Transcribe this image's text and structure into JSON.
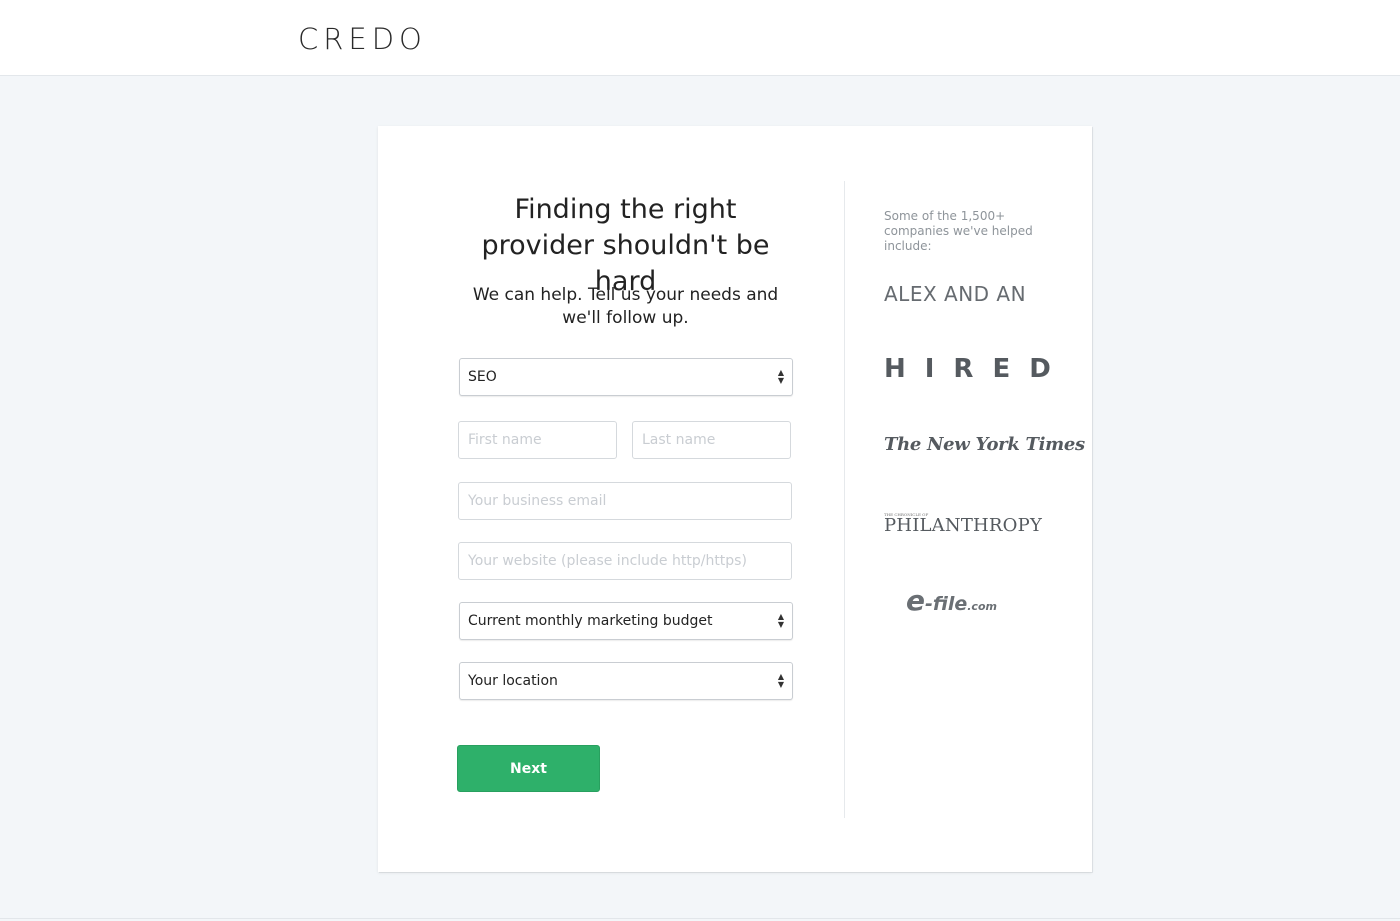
{
  "header": {
    "logo": "CREDO"
  },
  "form": {
    "headline": "Finding the right provider shouldn't be hard",
    "subhead": "We can help. Tell us your needs and we'll follow up.",
    "service_select": {
      "value": "SEO"
    },
    "first_name": {
      "placeholder": "First name"
    },
    "last_name": {
      "placeholder": "Last name"
    },
    "email": {
      "placeholder": "Your business email"
    },
    "website": {
      "placeholder": "Your website (please include http/https)"
    },
    "budget_select": {
      "value": "Current monthly marketing budget"
    },
    "location_select": {
      "value": "Your location"
    },
    "next_label": "Next"
  },
  "sidebar": {
    "intro": "Some of the 1,500+ companies we've helped include:",
    "logos": {
      "alex_and_ani": "ALEX AND ANI",
      "hired": "HIRED",
      "nyt": "The New York Times",
      "philanthropy_small": "THE CHRONICLE OF",
      "philanthropy": "PHILANTHROPY",
      "efile_e": "e",
      "efile_rest": "-file",
      "efile_com": ".com"
    }
  },
  "colors": {
    "page_bg": "#f3f6f9",
    "accent_green": "#2eb06a",
    "text_dark": "#222222",
    "text_muted": "#8e949a"
  },
  "icons": [
    "select-arrows-icon"
  ]
}
